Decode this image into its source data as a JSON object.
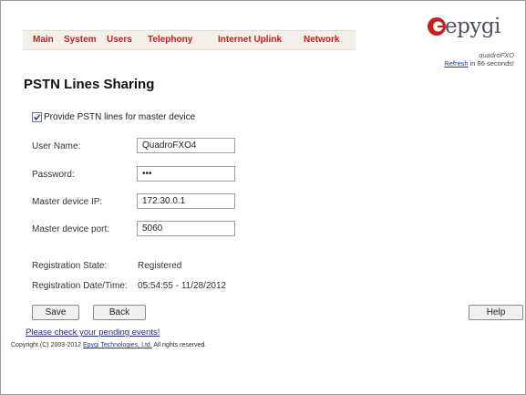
{
  "nav": {
    "items": [
      "Main",
      "System",
      "Users",
      "Telephony",
      "Internet Uplink",
      "Network"
    ]
  },
  "brand": {
    "logo_text": "epygi",
    "product": "quadroFXO",
    "refresh_link": "Refresh",
    "refresh_suffix": " in 86 seconds!"
  },
  "page": {
    "title": "PSTN Lines Sharing"
  },
  "form": {
    "provide_checkbox_label": "Provide PSTN lines for master device",
    "provide_checked": true,
    "user_name_label": "User Name:",
    "user_name_value": "QuadroFXO4",
    "password_label": "Password:",
    "password_value": "•••",
    "master_ip_label": "Master device IP:",
    "master_ip_value": "172.30.0.1",
    "master_port_label": "Master device port:",
    "master_port_value": "5060"
  },
  "status": {
    "registration_state_label": "Registration State:",
    "registration_state_value": "Registered",
    "registration_dt_label": "Registration Date/Time:",
    "registration_dt_value": "05:54:55 - 11/28/2012"
  },
  "buttons": {
    "save": "Save",
    "back": "Back",
    "help": "Help"
  },
  "footer": {
    "events_link": "Please check your pending events!",
    "copyright_prefix": "Copyright (C) 2003-2012 ",
    "copyright_link": "Epygi Technologies, Ltd.",
    "copyright_suffix": " All rights reserved."
  },
  "colors": {
    "nav_red": "#c81e1e",
    "link_blue": "#1e3c9a"
  }
}
